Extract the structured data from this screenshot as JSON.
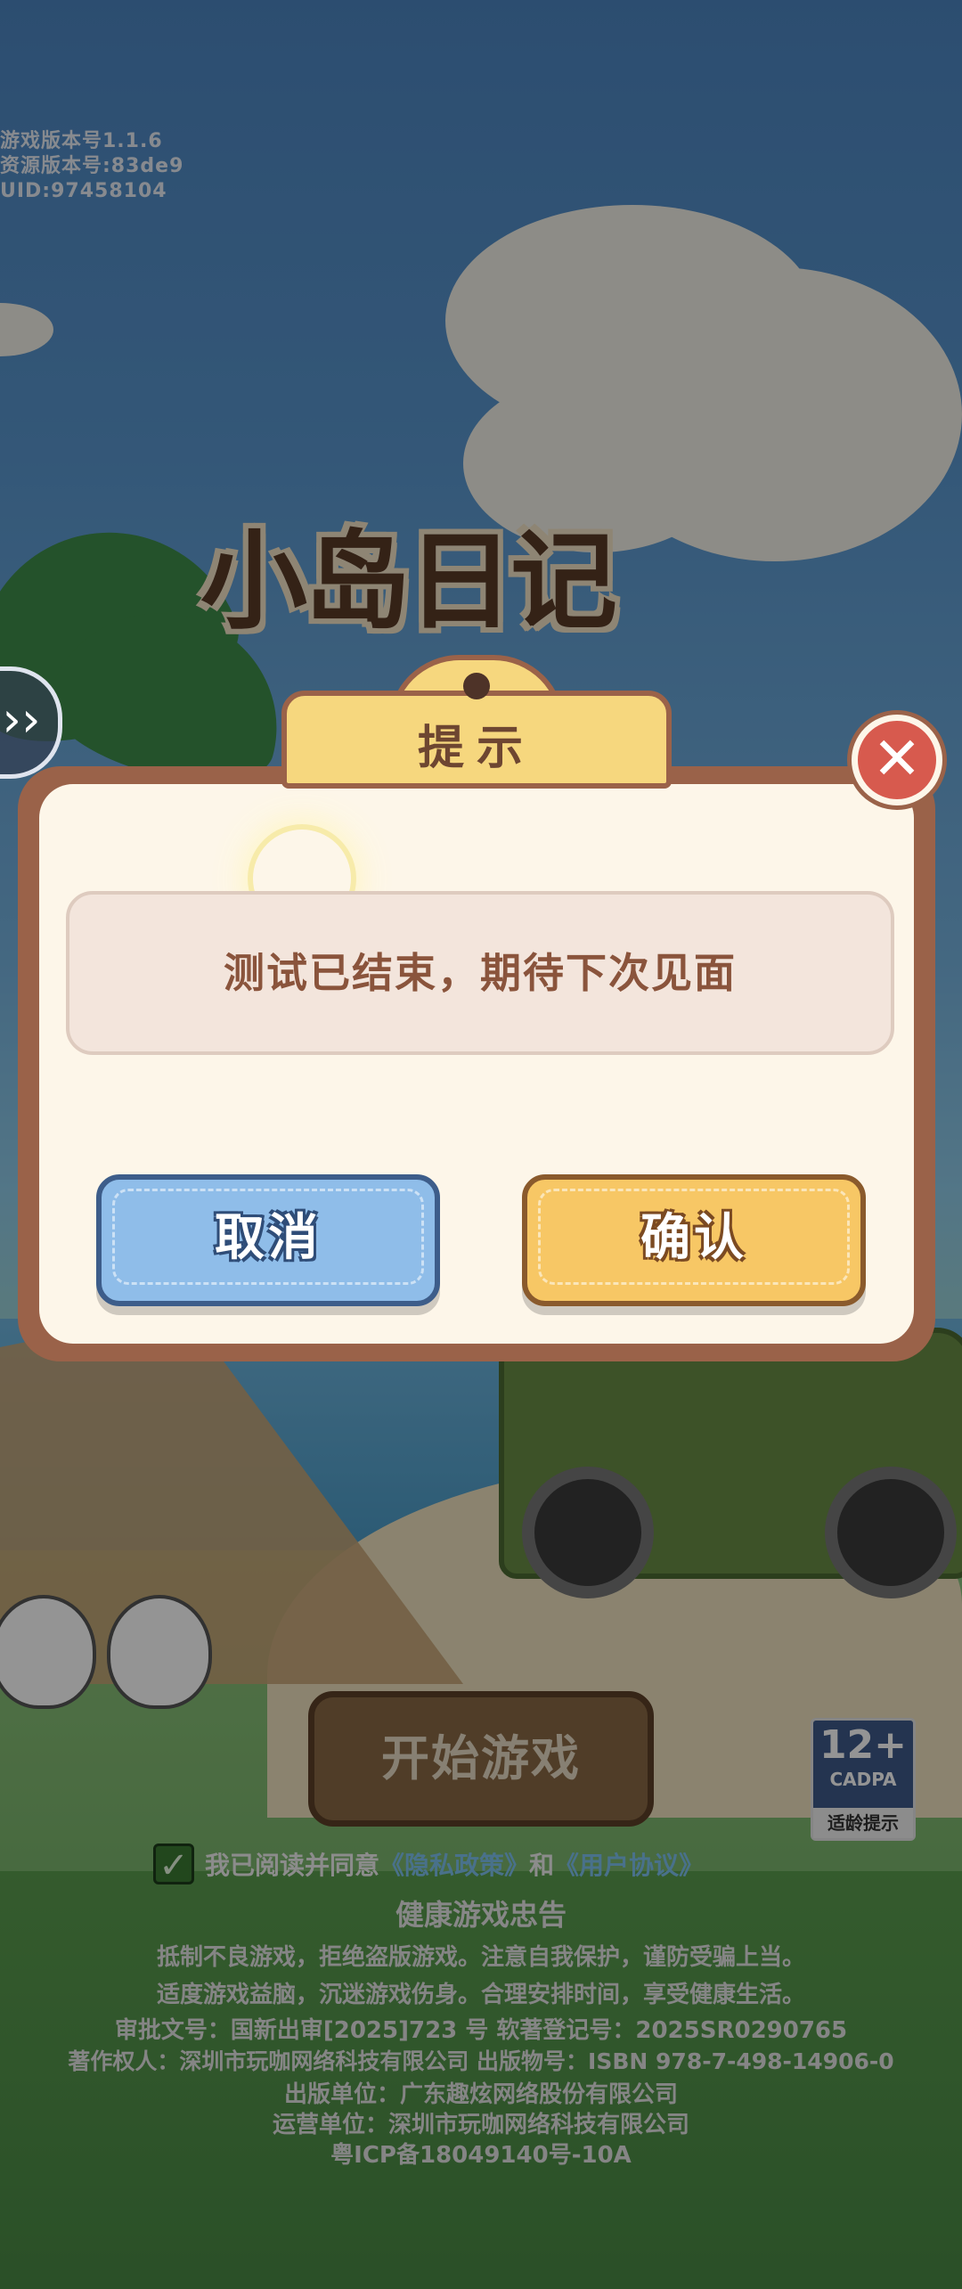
{
  "version_info": {
    "game_version": "游戏版本号1.1.6",
    "resource_version": "资源版本号:83de9",
    "uid": "UID:97458104"
  },
  "logo": {
    "text": "小岛日记"
  },
  "side_nav": {
    "arrow": "››"
  },
  "dialog": {
    "title": "提示",
    "message": "测试已结束，期待下次见面",
    "cancel_label": "取消",
    "confirm_label": "确认",
    "close_symbol": "✕"
  },
  "start_button": {
    "label": "开始游戏"
  },
  "age_rating": {
    "rating": "12+",
    "org": "CADPA",
    "tip": "适龄提示"
  },
  "agreement": {
    "prefix": "我已阅读并同意",
    "privacy_link": "《隐私政策》",
    "conjunction": "和",
    "terms_link": "《用户协议》",
    "checked": true
  },
  "health_notice": {
    "title": "健康游戏忠告",
    "line1": "抵制不良游戏，拒绝盗版游戏。注意自我保护，谨防受骗上当。",
    "line2": "适度游戏益脑，沉迷游戏伤身。合理安排时间，享受健康生活。"
  },
  "legal": {
    "approval": "审批文号：国新出审[2025]723 号  软著登记号：2025SR0290765",
    "copyright": "著作权人：深圳市玩咖网络科技有限公司  出版物号：ISBN 978-7-498-14906-0",
    "publisher": "出版单位：广东趣炫网络股份有限公司",
    "operator": "运营单位：深圳市玩咖网络科技有限公司",
    "icp": "粤ICP备18049140号-10A"
  }
}
